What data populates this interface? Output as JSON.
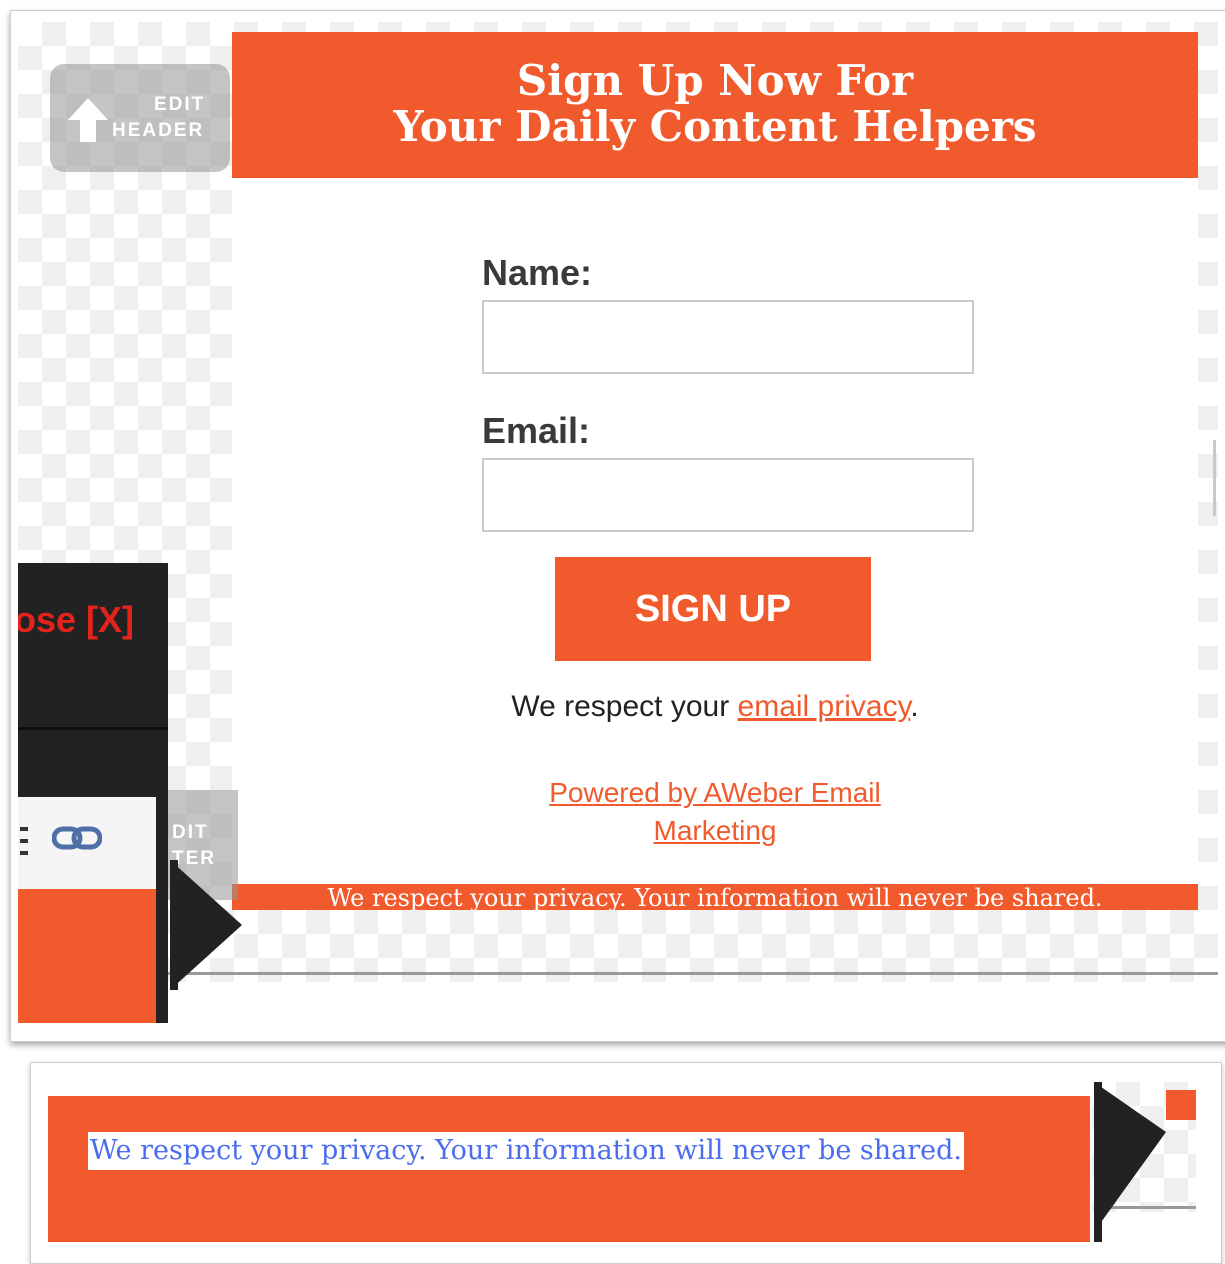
{
  "editor": {
    "edit_header_label_1": "EDIT",
    "edit_header_label_2": "HEADER",
    "edit_footer_label_1": "DIT",
    "edit_footer_label_2": "TER",
    "close_label": "ose [X]"
  },
  "form": {
    "header_line_1": "Sign Up Now For",
    "header_line_2": "Your Daily Content Helpers",
    "name_label": "Name:",
    "name_value": "",
    "email_label": "Email:",
    "email_value": "",
    "submit_label": "SIGN UP",
    "privacy_prefix": "We respect your ",
    "privacy_link": "email privacy",
    "privacy_suffix": ".",
    "powered_line_1": "Powered by AWeber Email",
    "powered_line_2": "Marketing",
    "footer_text": "We respect your privacy. Your information will never be shared."
  },
  "footer_editor": {
    "selected_text": "We respect your privacy. Your information will never be shared."
  },
  "colors": {
    "brand_orange": "#f05a2c",
    "editor_dark": "#222222",
    "close_red": "#e2241b",
    "selection_text_blue": "#4a6cf0"
  },
  "icons": [
    "up-arrow-icon",
    "link-icon",
    "menu-icon",
    "pointer-triangle-icon"
  ]
}
